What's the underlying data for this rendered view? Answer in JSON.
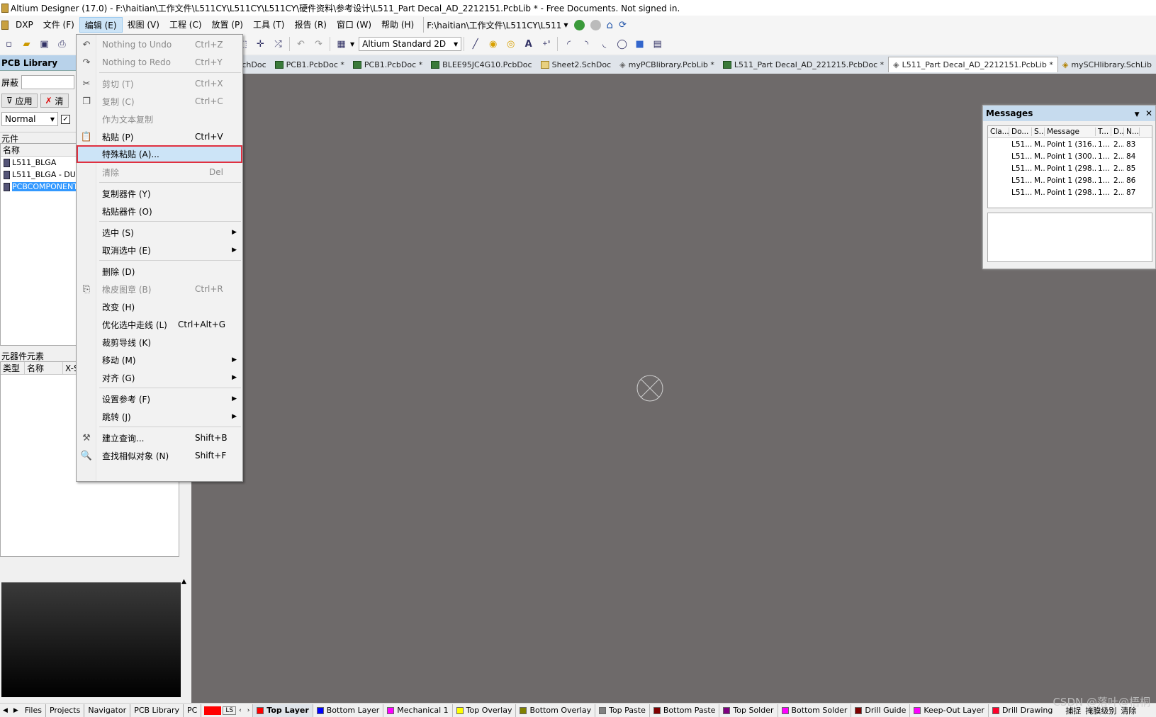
{
  "window": {
    "title": "Altium Designer (17.0) - F:\\haitian\\工作文件\\L511CY\\L511CY\\L511CY\\硬件资料\\参考设计\\L511_Part Decal_AD_2212151.PcbLib * - Free Documents. Not signed in."
  },
  "menubar": {
    "items": [
      "DXP",
      "文件 (F)",
      "编辑 (E)",
      "视图 (V)",
      "工程 (C)",
      "放置 (P)",
      "工具 (T)",
      "报告 (R)",
      "窗口 (W)",
      "帮助 (H)"
    ],
    "path": "F:\\haitian\\工作文件\\L511CY\\L511"
  },
  "toolbar": {
    "view_mode": "Altium Standard 2D"
  },
  "left_panel": {
    "title": "PCB Library",
    "mask_label": "屏蔽",
    "apply_label": "应用",
    "clear_label": "清",
    "mode": "Normal",
    "components_label": "元件",
    "name_col": "名称",
    "components": [
      "L511_BLGA",
      "L511_BLGA - DUP",
      "PCBCOMPONENT"
    ],
    "primitives_label": "元器件元素",
    "prim_cols": [
      "类型",
      "名称",
      "X-S"
    ]
  },
  "doc_tabs": [
    {
      "label": "chDoc",
      "type": "sch"
    },
    {
      "label": "PCB1.PcbDoc *",
      "type": "pcb"
    },
    {
      "label": "PCB1.PcbDoc *",
      "type": "pcb"
    },
    {
      "label": "BLEE95JC4G10.PcbDoc",
      "type": "pcb"
    },
    {
      "label": "Sheet2.SchDoc",
      "type": "sch"
    },
    {
      "label": "myPCBlibrary.PcbLib *",
      "type": "lib"
    },
    {
      "label": "L511_Part Decal_AD_221215.PcbDoc *",
      "type": "pcb"
    },
    {
      "label": "L511_Part Decal_AD_2212151.PcbLib *",
      "type": "lib"
    },
    {
      "label": "mySCHlibrary.SchLib",
      "type": "sch"
    }
  ],
  "messages": {
    "title": "Messages",
    "columns": [
      "Cla...",
      "Do...",
      "S...",
      "Message",
      "T...",
      "D...",
      "N..."
    ],
    "rows": [
      [
        "",
        "L51...",
        "M...",
        "Point 1 (316....",
        "1...",
        "2...",
        "83"
      ],
      [
        "",
        "L51...",
        "M...",
        "Point 1 (300....",
        "1...",
        "2...",
        "84"
      ],
      [
        "",
        "L51...",
        "M...",
        "Point 1 (298....",
        "1...",
        "2...",
        "85"
      ],
      [
        "",
        "L51...",
        "M...",
        "Point 1 (298....",
        "1...",
        "2...",
        "86"
      ],
      [
        "",
        "L51...",
        "M...",
        "Point 1 (298....",
        "1...",
        "2...",
        "87"
      ]
    ]
  },
  "edit_menu": {
    "items": [
      {
        "label": "Nothing to Undo",
        "shortcut": "Ctrl+Z",
        "disabled": true,
        "icon": "undo-icon"
      },
      {
        "label": "Nothing to Redo",
        "shortcut": "Ctrl+Y",
        "disabled": true,
        "icon": "redo-icon"
      },
      {
        "label": "剪切 (T)",
        "shortcut": "Ctrl+X",
        "disabled": true,
        "icon": "cut-icon"
      },
      {
        "label": "复制 (C)",
        "shortcut": "Ctrl+C",
        "disabled": true,
        "icon": "copy-icon"
      },
      {
        "label": "作为文本复制",
        "shortcut": "",
        "disabled": true
      },
      {
        "label": "粘贴 (P)",
        "shortcut": "Ctrl+V",
        "icon": "paste-icon"
      },
      {
        "label": "特殊粘贴 (A)...",
        "shortcut": "",
        "highlighted": true
      },
      {
        "label": "清除",
        "shortcut": "Del",
        "disabled": true
      },
      {
        "label": "复制器件 (Y)",
        "shortcut": ""
      },
      {
        "label": "粘贴器件 (O)",
        "shortcut": ""
      },
      {
        "label": "选中 (S)",
        "submenu": true
      },
      {
        "label": "取消选中 (E)",
        "submenu": true
      },
      {
        "label": "删除 (D)",
        "shortcut": ""
      },
      {
        "label": "橡皮图章 (B)",
        "shortcut": "Ctrl+R",
        "disabled": true,
        "icon": "stamp-icon"
      },
      {
        "label": "改变 (H)",
        "shortcut": ""
      },
      {
        "label": "优化选中走线 (L)",
        "shortcut": "Ctrl+Alt+G"
      },
      {
        "label": "裁剪导线 (K)",
        "shortcut": ""
      },
      {
        "label": "移动 (M)",
        "submenu": true
      },
      {
        "label": "对齐 (G)",
        "submenu": true
      },
      {
        "label": "设置参考 (F)",
        "submenu": true
      },
      {
        "label": "跳转 (J)",
        "submenu": true
      },
      {
        "label": "建立查询...",
        "shortcut": "Shift+B",
        "icon": "query-icon"
      },
      {
        "label": "查找相似对象 (N)",
        "shortcut": "Shift+F",
        "icon": "find-icon"
      }
    ]
  },
  "bottom": {
    "panel_tabs": [
      "Files",
      "Projects",
      "Navigator",
      "PCB Library",
      "PC"
    ],
    "ls_label": "LS",
    "layers": [
      {
        "name": "Top Layer",
        "color": "#ff0000",
        "active": true
      },
      {
        "name": "Bottom Layer",
        "color": "#0000ff"
      },
      {
        "name": "Mechanical 1",
        "color": "#ff00ff"
      },
      {
        "name": "Top Overlay",
        "color": "#ffff00"
      },
      {
        "name": "Bottom Overlay",
        "color": "#808000"
      },
      {
        "name": "Top Paste",
        "color": "#808080"
      },
      {
        "name": "Bottom Paste",
        "color": "#800000"
      },
      {
        "name": "Top Solder",
        "color": "#800080"
      },
      {
        "name": "Bottom Solder",
        "color": "#ff00ff"
      },
      {
        "name": "Drill Guide",
        "color": "#800000"
      },
      {
        "name": "Keep-Out Layer",
        "color": "#ff00ff"
      },
      {
        "name": "Drill Drawing",
        "color": "#ff002a"
      }
    ],
    "right_labels": [
      "捕捉",
      "掩膜级别",
      "清除"
    ]
  },
  "watermark": "CSDN @落叶@梧桐"
}
